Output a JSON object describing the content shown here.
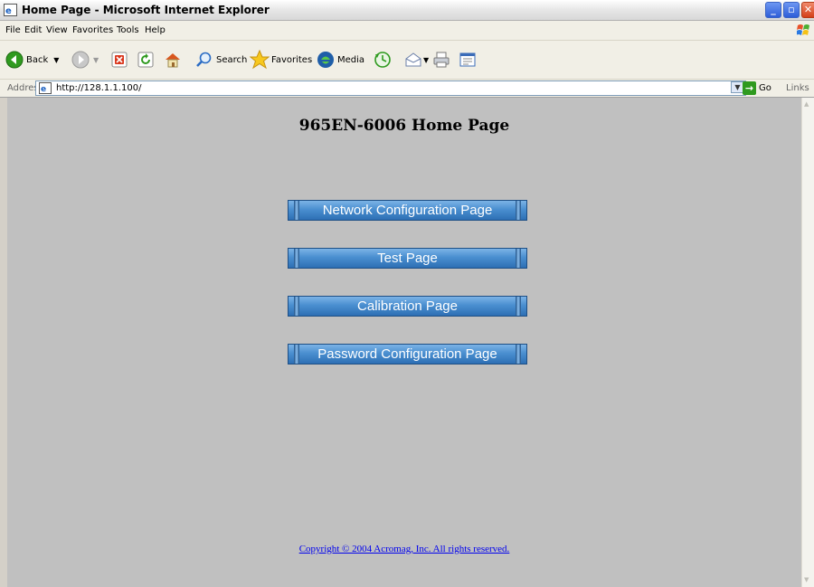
{
  "window": {
    "title": "Home Page - Microsoft Internet Explorer",
    "controls": {
      "minimize": "_",
      "maximize": "▫",
      "close": "✕"
    }
  },
  "menu": {
    "items": [
      "File",
      "Edit",
      "View",
      "Favorites",
      "Tools",
      "Help"
    ]
  },
  "toolbar": {
    "back_label": "Back",
    "search_label": "Search",
    "favorites_label": "Favorites",
    "media_label": "Media"
  },
  "addressbar": {
    "label": "Address",
    "url": "http://128.1.1.100/",
    "go_label": "Go",
    "links_label": "Links"
  },
  "page": {
    "heading": "965EN-6006 Home Page",
    "buttons": [
      {
        "label": "Network Configuration Page"
      },
      {
        "label": "Test Page"
      },
      {
        "label": "Calibration Page"
      },
      {
        "label": "Password Configuration Page"
      }
    ],
    "copyright": "Copyright © 2004 Acromag, Inc. All rights reserved."
  }
}
